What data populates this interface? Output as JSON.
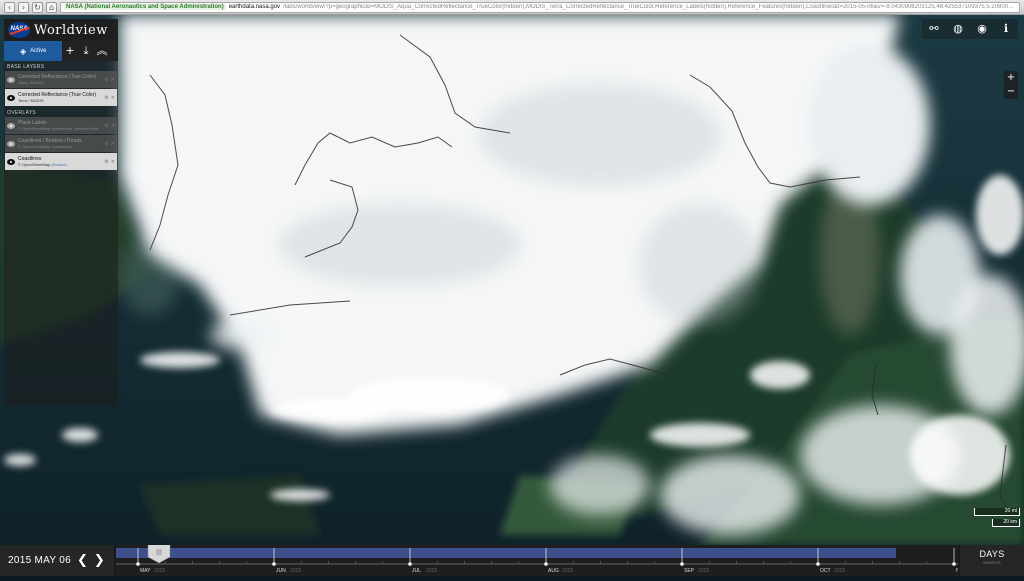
{
  "browser": {
    "secure_label": "NASA (National Aeronautics and Space Administration)",
    "host": "earthdata.nasa.gov",
    "path": "/labs/worldview/?p=geographic&l=MODIS_Aqua_CorrectedReflectance_TrueColor(hidden),MODIS_Terra_CorrectedReflectance_TrueColor,Reference_Labels(hidden),Reference_Features(hidden),Coastlines&t=2015-05-06&v=-8.0430908203125,48.425537109375,5.2080078125,54.3778076171875",
    "buttons": {
      "back": "‹",
      "forward": "›",
      "reload": "↻",
      "home": "⌂"
    }
  },
  "app": {
    "logo_text": "NASA",
    "name": "Worldview"
  },
  "sidebar": {
    "active_tab": "Active",
    "add_icon": "+",
    "download_icon": "⤓",
    "collapse_icon": "︽",
    "base_layers_title": "BASE LAYERS",
    "base_layers": [
      {
        "title": "Corrected Reflectance (True Color)",
        "subtitle": "Aqua / MODIS",
        "visible": false
      },
      {
        "title": "Corrected Reflectance (True Color)",
        "subtitle": "Terra / MODIS",
        "visible": true
      }
    ],
    "overlays_title": "OVERLAYS",
    "overlays": [
      {
        "title": "Place Labels",
        "subtitle": "© OpenStreetMap contributors, Natural Earth",
        "visible": false
      },
      {
        "title": "Coastlines / Borders / Roads",
        "subtitle": "© OpenStreetMap contributors",
        "visible": false
      },
      {
        "title": "Coastlines",
        "subtitle": "© OpenStreetMap",
        "source_link": "(Source)",
        "visible": true
      }
    ],
    "layer_tool_icons": {
      "info": "⚙",
      "close": "✕"
    }
  },
  "toolbar": {
    "link_icon": "⚯",
    "projection_icon": "◍",
    "camera_icon": "◉",
    "info_icon": "ℹ"
  },
  "zoom": {
    "in": "+",
    "out": "−"
  },
  "scale": {
    "miles": "20 mi",
    "km": "20 km"
  },
  "timeline": {
    "date": "2015 MAY 06",
    "prev": "❮",
    "next": "❯",
    "months": [
      "MAY",
      "JUN",
      "JUL",
      "AUG",
      "SEP",
      "OCT",
      "NOV"
    ],
    "year": "2015",
    "zoom_unit": "DAYS",
    "zoom_sub": "MONTHS",
    "handle_icon": "|||"
  },
  "colors": {
    "ocean": "#15303b",
    "land": "#23402a",
    "cloud": "#f2f4f5",
    "accent": "#1d5b9e",
    "timeline_fill": "#3d4f8c"
  }
}
